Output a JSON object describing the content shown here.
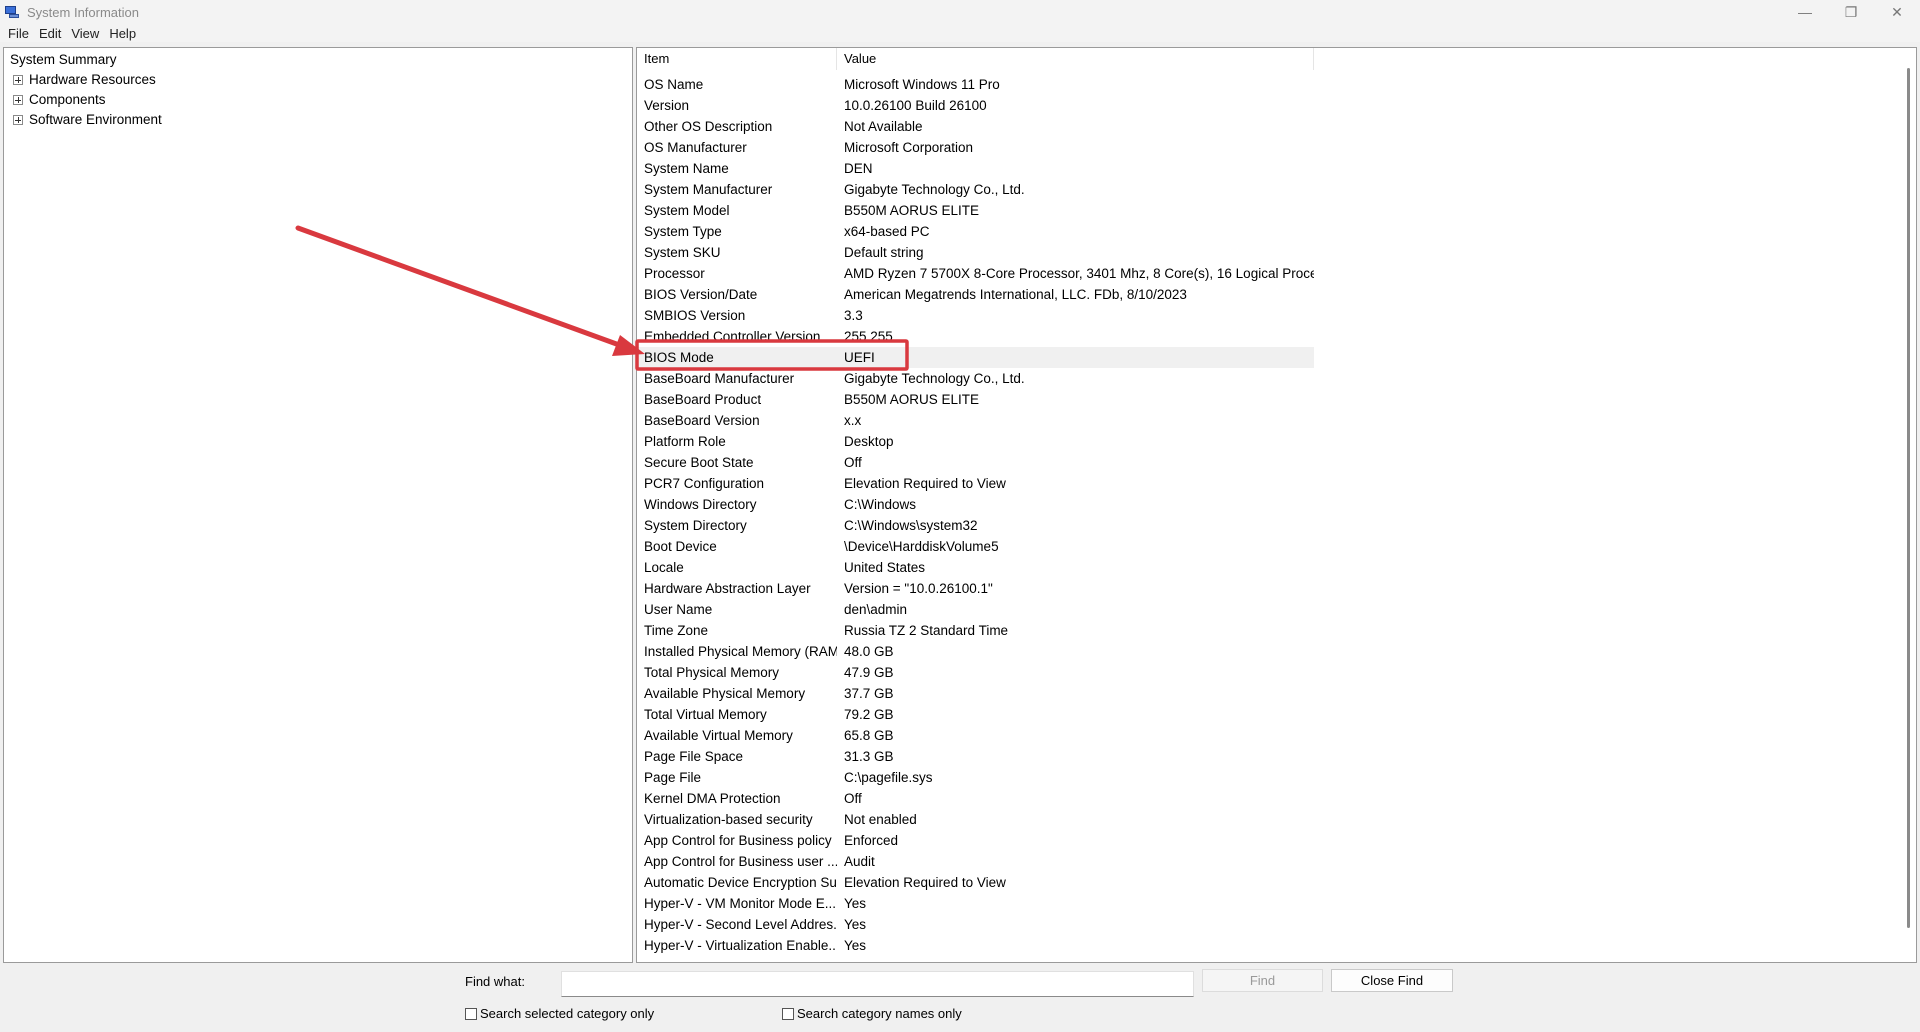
{
  "window": {
    "title": "System Information",
    "controls": {
      "minimize": "—",
      "maximize": "❐",
      "close": "✕"
    }
  },
  "menu": [
    "File",
    "Edit",
    "View",
    "Help"
  ],
  "tree": {
    "root": "System Summary",
    "children": [
      "Hardware Resources",
      "Components",
      "Software Environment"
    ]
  },
  "table": {
    "headers": {
      "item": "Item",
      "value": "Value"
    },
    "selected_row": "BIOS Mode",
    "rows": [
      [
        "OS Name",
        "Microsoft Windows 11 Pro"
      ],
      [
        "Version",
        "10.0.26100 Build 26100"
      ],
      [
        "Other OS Description",
        "Not Available"
      ],
      [
        "OS Manufacturer",
        "Microsoft Corporation"
      ],
      [
        "System Name",
        "DEN"
      ],
      [
        "System Manufacturer",
        "Gigabyte Technology Co., Ltd."
      ],
      [
        "System Model",
        "B550M AORUS ELITE"
      ],
      [
        "System Type",
        "x64-based PC"
      ],
      [
        "System SKU",
        "Default string"
      ],
      [
        "Processor",
        "AMD Ryzen 7 5700X 8-Core Processor, 3401 Mhz, 8 Core(s), 16 Logical Proce..."
      ],
      [
        "BIOS Version/Date",
        "American Megatrends International, LLC. FDb, 8/10/2023"
      ],
      [
        "SMBIOS Version",
        "3.3"
      ],
      [
        "Embedded Controller Version",
        "255.255"
      ],
      [
        "BIOS Mode",
        "UEFI"
      ],
      [
        "BaseBoard Manufacturer",
        "Gigabyte Technology Co., Ltd."
      ],
      [
        "BaseBoard Product",
        "B550M AORUS ELITE"
      ],
      [
        "BaseBoard Version",
        "x.x"
      ],
      [
        "Platform Role",
        "Desktop"
      ],
      [
        "Secure Boot State",
        "Off"
      ],
      [
        "PCR7 Configuration",
        "Elevation Required to View"
      ],
      [
        "Windows Directory",
        "C:\\Windows"
      ],
      [
        "System Directory",
        "C:\\Windows\\system32"
      ],
      [
        "Boot Device",
        "\\Device\\HarddiskVolume5"
      ],
      [
        "Locale",
        "United States"
      ],
      [
        "Hardware Abstraction Layer",
        "Version = \"10.0.26100.1\""
      ],
      [
        "User Name",
        "den\\admin"
      ],
      [
        "Time Zone",
        "Russia TZ 2 Standard Time"
      ],
      [
        "Installed Physical Memory (RAM)",
        "48.0 GB"
      ],
      [
        "Total Physical Memory",
        "47.9 GB"
      ],
      [
        "Available Physical Memory",
        "37.7 GB"
      ],
      [
        "Total Virtual Memory",
        "79.2 GB"
      ],
      [
        "Available Virtual Memory",
        "65.8 GB"
      ],
      [
        "Page File Space",
        "31.3 GB"
      ],
      [
        "Page File",
        "C:\\pagefile.sys"
      ],
      [
        "Kernel DMA Protection",
        "Off"
      ],
      [
        "Virtualization-based security",
        "Not enabled"
      ],
      [
        "App Control for Business policy",
        "Enforced"
      ],
      [
        "App Control for Business user ...",
        "Audit"
      ],
      [
        "Automatic Device Encryption Su...",
        "Elevation Required to View"
      ],
      [
        "Hyper-V - VM Monitor Mode E...",
        "Yes"
      ],
      [
        "Hyper-V - Second Level Addres...",
        "Yes"
      ],
      [
        "Hyper-V - Virtualization Enable...",
        "Yes"
      ]
    ]
  },
  "find": {
    "label": "Find what:",
    "value": "",
    "find_button": "Find",
    "close_button": "Close Find",
    "search_selected_label": "Search selected category only",
    "search_names_label": "Search category names only"
  },
  "colors": {
    "annotation": "#d9393f",
    "selected_row_bg": "#f0f0f0"
  }
}
